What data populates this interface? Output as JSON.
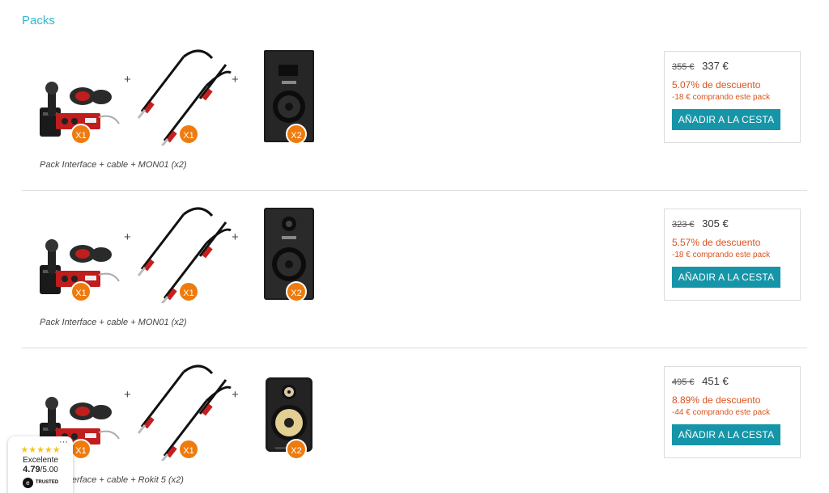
{
  "section": {
    "title": "Packs"
  },
  "packs": [
    {
      "plus": [
        "+",
        "+"
      ],
      "badges": [
        "X1",
        "X1",
        "X2"
      ],
      "name": "Pack Interface + cable + MON01 (x2)",
      "old_price": "355 €",
      "price": "337 €",
      "discount": "5.07% de descuento",
      "saving": "-18 € comprando este pack",
      "button": "AÑADIR A LA CESTA"
    },
    {
      "plus": [
        "+",
        "+"
      ],
      "badges": [
        "X1",
        "X1",
        "X2"
      ],
      "name": "Pack Interface + cable + MON01 (x2)",
      "old_price": "323 €",
      "price": "305 €",
      "discount": "5.57% de descuento",
      "saving": "-18 € comprando este pack",
      "button": "AÑADIR A LA CESTA"
    },
    {
      "plus": [
        "+",
        "+"
      ],
      "badges": [
        "X1",
        "X1",
        "X2"
      ],
      "name": "Pack Interface + cable + Rokit 5 (x2)",
      "old_price": "495 €",
      "price": "451 €",
      "discount": "8.89% de descuento",
      "saving": "-44 € comprando este pack",
      "button": "AÑADIR A LA CESTA"
    }
  ],
  "trust_badge": {
    "menu": "···",
    "stars": "★★★★★",
    "label": "Excelente",
    "score": "4.79",
    "scale": "/5.00",
    "logo_mark": "e",
    "logo_text": "TRUSTED"
  },
  "colors": {
    "title": "#31b7d2",
    "badge": "#ef7b0d",
    "discount": "#d9541e",
    "button": "#1695a8"
  },
  "icons": [
    "audio-interface-bundle-icon",
    "jack-cable-icon",
    "studio-monitor-icon",
    "rokit-monitor-icon",
    "star-icon"
  ]
}
